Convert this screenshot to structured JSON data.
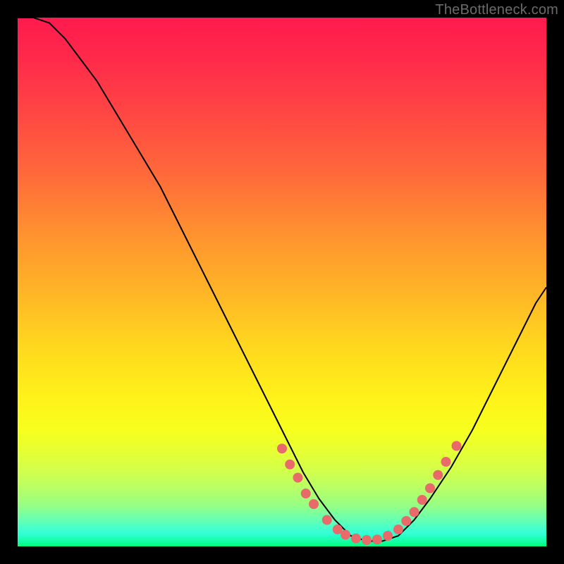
{
  "watermark": "TheBottleneck.com",
  "chart_data": {
    "type": "line",
    "title": "",
    "xlabel": "",
    "ylabel": "",
    "xlim": [
      0,
      100
    ],
    "ylim": [
      0,
      100
    ],
    "grid": false,
    "legend": false,
    "background_gradient": {
      "top": "#ff1a4e",
      "middle": "#fff21a",
      "bottom": "#00ff80"
    },
    "series": [
      {
        "name": "bottleneck-curve",
        "x": [
          0,
          3,
          6,
          9,
          12,
          15,
          18,
          21,
          24,
          27,
          30,
          33,
          36,
          39,
          42,
          45,
          48,
          51,
          54,
          57,
          60,
          63,
          66,
          69,
          72,
          75,
          78,
          82,
          86,
          90,
          94,
          98,
          100
        ],
        "y": [
          100,
          100,
          99,
          96,
          92,
          88,
          83,
          78,
          73,
          68,
          62,
          56,
          50,
          44,
          38,
          32,
          26,
          20,
          14,
          9,
          5,
          2,
          1,
          1,
          2,
          5,
          9,
          15,
          22,
          30,
          38,
          46,
          49
        ],
        "color": "#000000",
        "linewidth": 2
      }
    ],
    "markers": {
      "name": "highlight-dots",
      "color": "#e86a6a",
      "radius": 7,
      "points_xy": [
        [
          50,
          18.5
        ],
        [
          51.5,
          15.5
        ],
        [
          53,
          13
        ],
        [
          54.5,
          10
        ],
        [
          56,
          8
        ],
        [
          58.5,
          5
        ],
        [
          60.5,
          3.2
        ],
        [
          62,
          2.2
        ],
        [
          64,
          1.5
        ],
        [
          66,
          1.2
        ],
        [
          68,
          1.3
        ],
        [
          70,
          2
        ],
        [
          72,
          3.2
        ],
        [
          73.5,
          4.8
        ],
        [
          75,
          6.5
        ],
        [
          76.5,
          8.8
        ],
        [
          78,
          11
        ],
        [
          79.5,
          13.5
        ],
        [
          81,
          16
        ],
        [
          83,
          19
        ]
      ]
    }
  }
}
